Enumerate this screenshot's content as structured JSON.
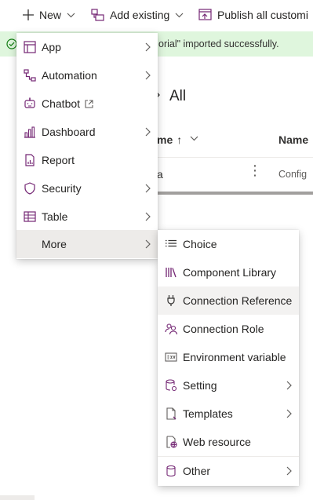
{
  "toolbar": {
    "new_label": "New",
    "add_existing_label": "Add existing",
    "publish_label": "Publish all customi"
  },
  "message_bar": {
    "text": "orial\" imported successfully."
  },
  "page": {
    "breadcrumb_current": "All",
    "columns": {
      "name": "me",
      "sort_indicator": "↑",
      "second": "Name"
    },
    "row": {
      "name_fragment": "a",
      "more": "⋮",
      "type_fragment": "Config"
    }
  },
  "main_menu": {
    "items": [
      {
        "label": "App",
        "icon": "app-icon",
        "has_submenu": true
      },
      {
        "label": "Automation",
        "icon": "automation-icon",
        "has_submenu": true
      },
      {
        "label": "Chatbot",
        "icon": "chatbot-icon",
        "has_submenu": false,
        "external": true
      },
      {
        "label": "Dashboard",
        "icon": "dashboard-icon",
        "has_submenu": true
      },
      {
        "label": "Report",
        "icon": "report-icon",
        "has_submenu": false
      },
      {
        "label": "Security",
        "icon": "shield-icon",
        "has_submenu": true
      },
      {
        "label": "Table",
        "icon": "table-icon",
        "has_submenu": true
      },
      {
        "label": "More",
        "icon": "",
        "has_submenu": true,
        "selected": true
      }
    ]
  },
  "sub_menu": {
    "items": [
      {
        "label": "Choice",
        "icon": "list-icon",
        "has_submenu": false
      },
      {
        "label": "Component Library",
        "icon": "library-icon",
        "has_submenu": false
      },
      {
        "label": "Connection Reference",
        "icon": "plug-icon",
        "has_submenu": false,
        "hovered": true
      },
      {
        "label": "Connection Role",
        "icon": "people-icon",
        "has_submenu": false
      },
      {
        "label": "Environment variable",
        "icon": "variable-icon",
        "has_submenu": false
      },
      {
        "label": "Setting",
        "icon": "database-settings-icon",
        "has_submenu": true
      },
      {
        "label": "Templates",
        "icon": "document-icon",
        "has_submenu": true
      },
      {
        "label": "Web resource",
        "icon": "web-document-icon",
        "has_submenu": false
      },
      {
        "label": "Other",
        "icon": "database-icon",
        "has_submenu": true
      }
    ]
  },
  "colors": {
    "accent": "#742774",
    "success_bg": "#dff6dd",
    "success_icon": "#107c10",
    "selected_bg": "#edebe9",
    "hover_bg": "#f3f2f1"
  }
}
